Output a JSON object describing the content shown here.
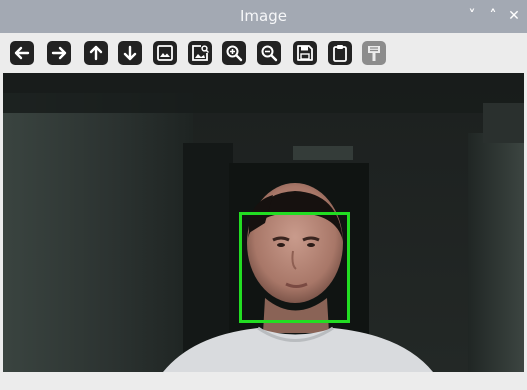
{
  "window": {
    "title": "Image"
  },
  "window_controls": [
    {
      "name": "minimize",
      "glyph": "˅"
    },
    {
      "name": "maximize",
      "glyph": "˄"
    },
    {
      "name": "close",
      "glyph": "✕"
    }
  ],
  "toolbar": {
    "buttons": [
      {
        "icon": "arrow-left-icon",
        "action": "pan-left"
      },
      {
        "icon": "arrow-right-icon",
        "action": "pan-right"
      },
      {
        "icon": "arrow-up-icon",
        "action": "pan-up"
      },
      {
        "icon": "arrow-down-icon",
        "action": "pan-down"
      },
      {
        "icon": "image-icon",
        "action": "fit-image"
      },
      {
        "icon": "image-search-icon",
        "action": "actual-size"
      },
      {
        "icon": "zoom-in-icon",
        "action": "zoom-in"
      },
      {
        "icon": "zoom-out-icon",
        "action": "zoom-out"
      },
      {
        "icon": "save-icon",
        "action": "save"
      },
      {
        "icon": "clipboard-icon",
        "action": "copy"
      },
      {
        "icon": "properties-icon",
        "action": "properties",
        "state": "disabled"
      }
    ]
  },
  "detection": {
    "label": "face",
    "box_color": "#22dd22"
  },
  "colors": {
    "titlebar": "#a3a9b3",
    "toolbar": "#ececec",
    "icon": "#222222",
    "icon_disabled": "#8c8c8c"
  }
}
